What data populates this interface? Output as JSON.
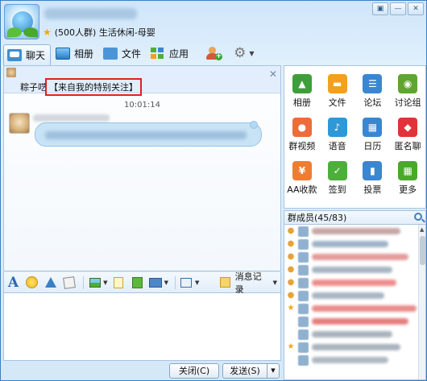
{
  "window": {
    "group_title": "(500人群) 生活休闲-母婴",
    "buttons": [
      "▣",
      "—",
      "✕"
    ]
  },
  "toolbar": {
    "tabs": [
      {
        "label": "聊天",
        "icon": "chat-icon"
      },
      {
        "label": "相册",
        "icon": "photo-album-icon"
      },
      {
        "label": "文件",
        "icon": "folder-icon"
      },
      {
        "label": "应用",
        "icon": "apps-icon"
      }
    ]
  },
  "chat": {
    "notice_prefix": "粽子呓",
    "notice_highlight": "【来自我的特别关注】",
    "timestamp": "10:01:14"
  },
  "input_toolbar": {
    "history_label": "消息记录"
  },
  "bottom": {
    "close_label": "关闭(C)",
    "send_label": "发送(S)"
  },
  "apps": [
    {
      "label": "相册",
      "color": "#3e9f3a",
      "glyph": "▲"
    },
    {
      "label": "文件",
      "color": "#f2a01e",
      "glyph": "▬"
    },
    {
      "label": "论坛",
      "color": "#3a86d1",
      "glyph": "☰"
    },
    {
      "label": "讨论组",
      "color": "#5fa530",
      "glyph": "◉"
    },
    {
      "label": "群视频",
      "color": "#ee6b3a",
      "glyph": "●"
    },
    {
      "label": "语音",
      "color": "#2f98d6",
      "glyph": "♪"
    },
    {
      "label": "日历",
      "color": "#3a86d1",
      "glyph": "▦"
    },
    {
      "label": "匿名聊",
      "color": "#e0333a",
      "glyph": "◆"
    },
    {
      "label": "AA收款",
      "color": "#ef7d31",
      "glyph": "¥"
    },
    {
      "label": "签到",
      "color": "#4caf3a",
      "glyph": "✓"
    },
    {
      "label": "投票",
      "color": "#3a86d1",
      "glyph": "▮"
    },
    {
      "label": "更多",
      "color": "#4aa82c",
      "glyph": "▦"
    }
  ],
  "members": {
    "header": "群成员(45/83)",
    "rows": [
      {
        "role": "owner",
        "name_color": "#c7a6a6",
        "w": 110
      },
      {
        "role": "admin",
        "name_color": "#9fb4c8",
        "w": 95
      },
      {
        "role": "admin",
        "name_color": "#e49b9b",
        "w": 120
      },
      {
        "role": "admin",
        "name_color": "#a7b6c4",
        "w": 100
      },
      {
        "role": "admin",
        "name_color": "#ec8d8d",
        "w": 105
      },
      {
        "role": "admin",
        "name_color": "#a8b5c2",
        "w": 90
      },
      {
        "role": "star",
        "name_color": "#e98c8c",
        "w": 130
      },
      {
        "role": "",
        "name_color": "#e57f7f",
        "w": 120
      },
      {
        "role": "",
        "name_color": "#aab4be",
        "w": 100
      },
      {
        "role": "star",
        "name_color": "#a9b3bd",
        "w": 110
      },
      {
        "role": "",
        "name_color": "#b0b9c2",
        "w": 95
      }
    ]
  }
}
